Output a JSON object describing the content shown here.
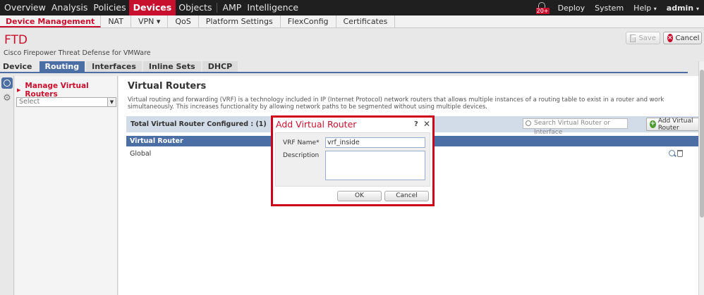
{
  "topnav": {
    "items": [
      "Overview",
      "Analysis",
      "Policies",
      "Devices",
      "Objects",
      "AMP",
      "Intelligence"
    ],
    "active": "Devices",
    "alert_count": "20+",
    "deploy": "Deploy",
    "system": "System",
    "help": "Help",
    "user": "admin",
    "caret": "▾"
  },
  "subnav": {
    "items": [
      "Device Management",
      "NAT",
      "VPN ▾",
      "QoS",
      "Platform Settings",
      "FlexConfig",
      "Certificates"
    ]
  },
  "device": {
    "title": "FTD",
    "subtitle": "Cisco Firepower Threat Defense for VMWare",
    "save_label": "Save",
    "cancel_label": "Cancel"
  },
  "tabs": [
    "Device",
    "Routing",
    "Interfaces",
    "Inline Sets",
    "DHCP"
  ],
  "left_panel": {
    "manage_label": "Manage Virtual Routers",
    "select_value": "Select"
  },
  "main": {
    "title": "Virtual Routers",
    "description": "Virtual routing and forwarding (VRF) is a technology included in IP (Internet Protocol) network routers that allows multiple instances of a routing table to exist in a router and work simultaneously. This increases functionality by allowing network paths to be segmented without using multiple devices.",
    "total_label": "Total Virtual Router Configured : (1)",
    "search_placeholder": "Search Virtual Router or Interface",
    "add_label": "Add Virtual Router",
    "column_header": "Virtual Router",
    "rows": [
      "Global"
    ]
  },
  "modal": {
    "title": "Add Virtual Router",
    "help": "?",
    "close": "✕",
    "vrf_label": "VRF Name*",
    "vrf_value": "vrf_inside",
    "desc_label": "Description",
    "desc_value": "",
    "ok_label": "OK",
    "cancel_label": "Cancel"
  },
  "colors": {
    "accent_red": "#c8102e",
    "tab_blue": "#4b6ea5",
    "highlight_border": "#d0021b"
  }
}
